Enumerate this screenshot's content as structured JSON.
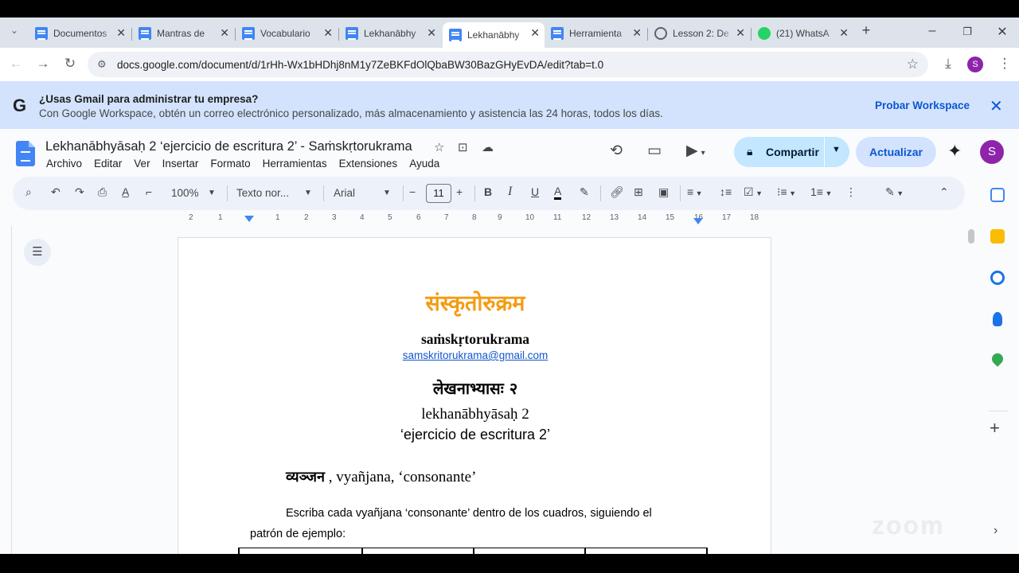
{
  "browser": {
    "tabs": [
      {
        "title": "Documentos",
        "icon": "docs-icon"
      },
      {
        "title": "Mantras de",
        "icon": "docs-icon"
      },
      {
        "title": "Vocabulario",
        "icon": "docs-icon"
      },
      {
        "title": "Lekhanābhy",
        "icon": "docs-icon"
      },
      {
        "title": "Lekhanābhy",
        "icon": "docs-icon",
        "active": true
      },
      {
        "title": "Herramienta",
        "icon": "docs-icon"
      },
      {
        "title": "Lesson 2: De",
        "icon": "globe-icon"
      },
      {
        "title": "(21) WhatsA",
        "icon": "whatsapp-icon"
      }
    ],
    "url": "docs.google.com/document/d/1rHh-Wx1bHDhj8nM1y7ZeBKFdOlQbaBW30BazGHyEvDA/edit?tab=t.0",
    "profile_initial": "S"
  },
  "banner": {
    "logo": "G",
    "title": "¿Usas Gmail para administrar tu empresa?",
    "description": "Con Google Workspace, obtén un correo electrónico personalizado, más almacenamiento y asistencia las 24 horas, todos los días.",
    "cta": "Probar Workspace"
  },
  "docs": {
    "title": "Lekhanābhyāsaḥ 2 ‘ejercicio de escritura 2’ - Saṁskṛtorukrama",
    "menu": [
      "Archivo",
      "Editar",
      "Ver",
      "Insertar",
      "Formato",
      "Herramientas",
      "Extensiones",
      "Ayuda"
    ],
    "share_label": "Compartir",
    "update_label": "Actualizar",
    "avatar_initial": "S"
  },
  "toolbar": {
    "zoom": "100%",
    "style": "Texto nor...",
    "font": "Arial",
    "font_size": "11"
  },
  "ruler": {
    "labels": [
      "2",
      "1",
      "1",
      "2",
      "3",
      "4",
      "5",
      "6",
      "7",
      "8",
      "9",
      "10",
      "11",
      "12",
      "13",
      "14",
      "15",
      "16",
      "17",
      "18"
    ]
  },
  "page": {
    "heading_devanagari": "संस्कृतोरुक्रम",
    "subheading": "saṁskṛtorukrama",
    "email": "samskritorukrama@gmail.com",
    "exercise_devanagari": "लेखनाभ्यासः २",
    "exercise_translit": "lekhanābhyāsaḥ 2",
    "exercise_spanish": "‘ejercicio de escritura 2’",
    "section_devanagari": "व्यञ्जन",
    "section_rest": " , vyañjana, ‘consonante’",
    "instruction_line1": "Escriba cada vyañjana ‘consonante’ dentro de los cuadros, siguiendo el",
    "instruction_line2": "patrón de ejemplo:"
  },
  "colors": {
    "heading": "#f39c12",
    "link": "#1155cc",
    "accent": "#0b57d0",
    "banner_bg": "#d3e3fd",
    "share_bg": "#c2e7ff"
  },
  "watermark": "zoom"
}
